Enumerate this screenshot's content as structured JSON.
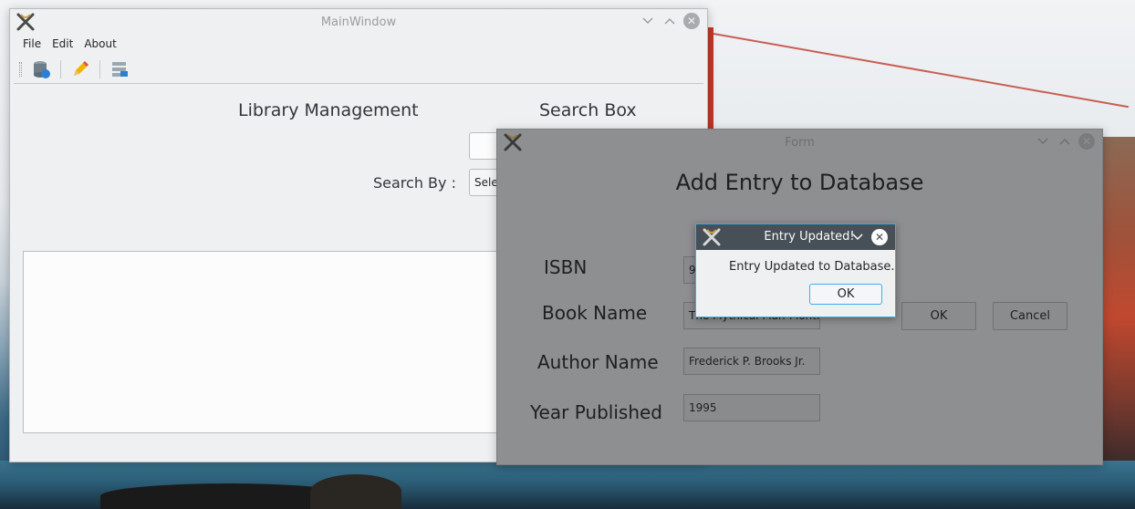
{
  "main_window": {
    "title": "MainWindow",
    "menu": [
      "File",
      "Edit",
      "About"
    ],
    "heading": "Library Management",
    "search_title": "Search Box",
    "search_input_value": "",
    "search_by_label": "Search By :",
    "search_by_value": "Sele"
  },
  "form_window": {
    "title": "Form",
    "heading": "Add Entry to Database",
    "fields": {
      "isbn_label": "ISBN",
      "isbn_value": "97",
      "book_name_label": "Book Name",
      "book_name_value": "The Mythical Man-Month",
      "author_name_label": "Author Name",
      "author_name_value": "Frederick P. Brooks Jr.",
      "year_label": "Year Published",
      "year_value": "1995"
    },
    "ok_label": "OK",
    "cancel_label": "Cancel"
  },
  "dialog": {
    "title": "Entry Updated!",
    "message": "Entry Updated to Database.",
    "ok_label": "OK"
  },
  "colors": {
    "accent": "#3daee9",
    "dialog_titlebar": "#475057",
    "window_bg": "#eff0f1",
    "dimmed_bg": "#8e8f90"
  },
  "icons": {
    "app": "x-app-icon",
    "database": "database-icon",
    "edit": "pencil-icon",
    "list": "list-icon"
  }
}
